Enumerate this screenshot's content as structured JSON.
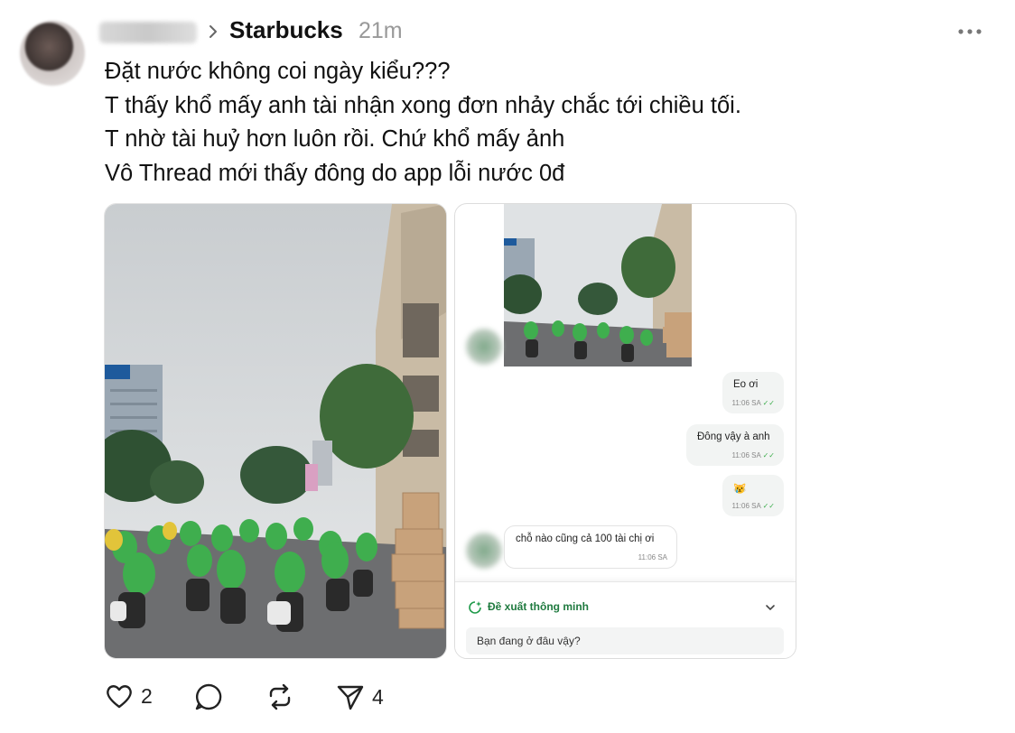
{
  "post": {
    "community": "Starbucks",
    "time": "21m",
    "lines": [
      "Đặt nước không coi ngày kiểu???",
      "T thấy khổ mấy anh tài nhận xong đơn nhảy chắc tới chiều tối.",
      "T nhờ tài huỷ hơn luôn rồi. Chứ khổ mấy ảnh",
      "Vô Thread mới thấy đông do app lỗi nước 0đ"
    ]
  },
  "chat": {
    "messages": [
      {
        "text": "Eo ơi",
        "time": "11:06 SA"
      },
      {
        "text": "Đông vậy à anh",
        "time": "11:06 SA"
      },
      {
        "text": "😿",
        "time": "11:06 SA"
      },
      {
        "text": "chỗ nào cũng cả 100 tài chị ơi",
        "time": "11:06 SA"
      }
    ],
    "smart_suggest": "Đề xuất thông minh",
    "input_value": "Bạn đang ở đâu vậy?"
  },
  "actions": {
    "like_count": "2",
    "share_count": "4"
  },
  "colors": {
    "text": "#111111",
    "muted": "#999999",
    "grab_green": "#1f9a4a",
    "jacket_green": "#3fae4e"
  }
}
